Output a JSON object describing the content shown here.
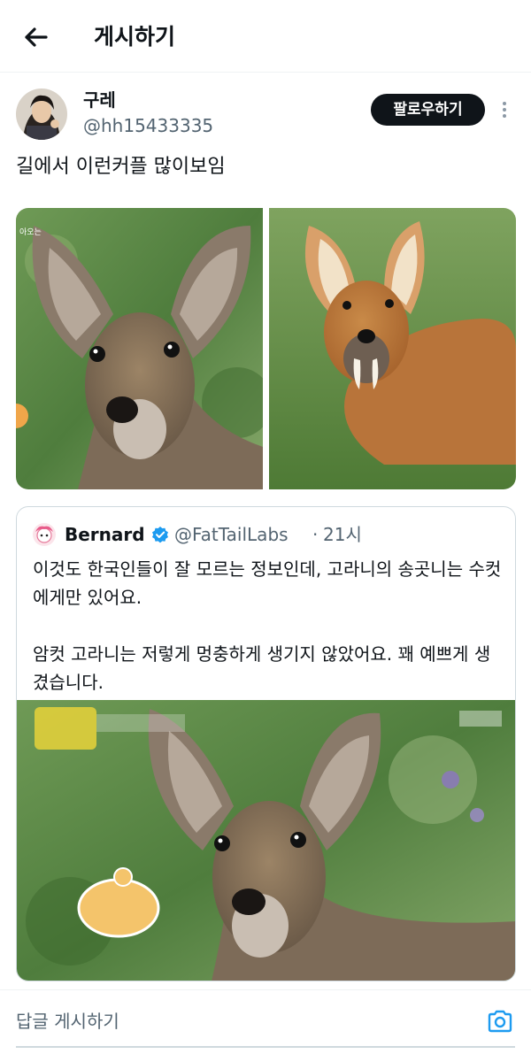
{
  "header": {
    "title": "게시하기",
    "back_icon": "arrow-left-icon"
  },
  "post": {
    "author_name": "구레",
    "author_handle": "@hh15433335",
    "follow_label": "팔로우하기",
    "more_icon": "more-vertical-icon",
    "text": "길에서 이런커플 많이보임",
    "media": [
      "deer-photo",
      "water-deer-with-tusks-photo"
    ]
  },
  "quote": {
    "author_name": "Bernard",
    "verified_icon": "verified-badge-icon",
    "author_handle": "@FatTailLabs",
    "separator": "·",
    "time": "21시",
    "paragraph1": "이것도 한국인들이 잘 모르는 정보인데, 고라니의 송곳니는 수컷에게만 있어요.",
    "paragraph2": "암컷 고라니는 저렇게 멍충하게 생기지 않았어요. 꽤 예쁘게 생겼습니다.",
    "media": "deer-tv-screenshot"
  },
  "reply": {
    "placeholder": "답글 게시하기",
    "camera_icon": "camera-icon"
  },
  "colors": {
    "text_primary": "#0f1419",
    "text_secondary": "#536471",
    "accent": "#1d9bf0",
    "border": "#cfd9de"
  }
}
